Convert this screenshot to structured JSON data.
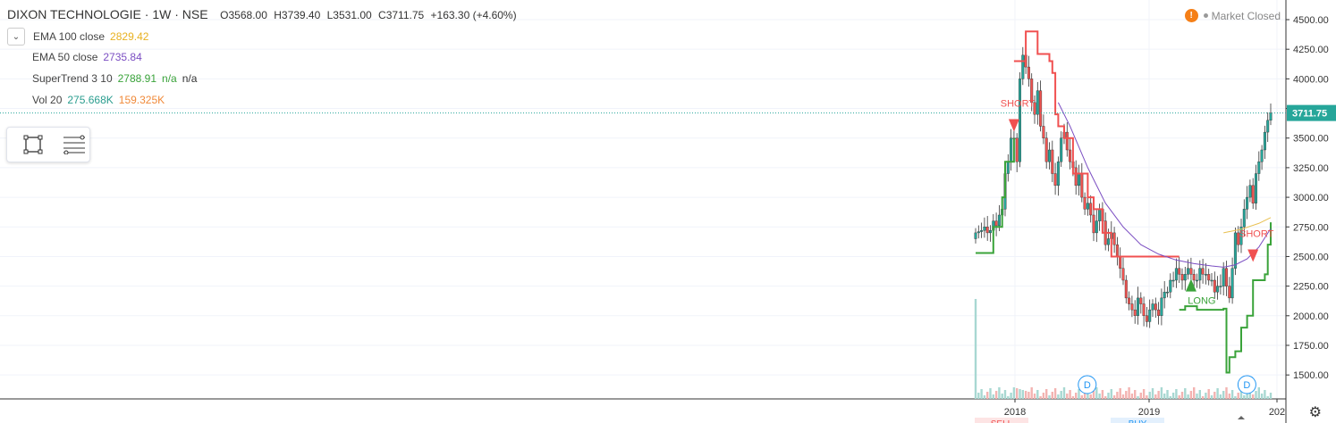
{
  "header": {
    "title": "DIXON TECHNOLOGIE · 1W · NSE",
    "open": "O3568.00",
    "high": "H3739.40",
    "low": "L3531.00",
    "close": "C3711.75",
    "change": "+163.30 (+4.60%)"
  },
  "indicators": [
    {
      "label": "EMA 100 close",
      "values": [
        "2829.42"
      ],
      "colors": [
        "#e8b120"
      ]
    },
    {
      "label": "EMA 50 close",
      "values": [
        "2735.84"
      ],
      "colors": [
        "#7b4ec2"
      ]
    },
    {
      "label": "SuperTrend 3 10",
      "values": [
        "2788.91",
        "n/a",
        "n/a"
      ],
      "colors": [
        "#3aa33a",
        "#3aa33a",
        "#333333"
      ]
    },
    {
      "label": "Vol 20",
      "values": [
        "275.668K",
        "159.325K"
      ],
      "colors": [
        "#2a9d8f",
        "#f08a3a"
      ]
    }
  ],
  "market_status": "Market Closed",
  "price_label": "3711.75",
  "icons": {
    "warning": "!",
    "settings": "⚙"
  },
  "colors": {
    "up": "#26a69a",
    "down": "#ef5350",
    "supertrend_up": "#3aa33a",
    "supertrend_down": "#f05050",
    "ema50": "#7b4ec2",
    "ema100": "#e8c050"
  },
  "chart_data": {
    "type": "candlestick",
    "title": "DIXON TECHNOLOGIE · 1W · NSE",
    "y_ticks": [
      1500,
      1750,
      2000,
      2250,
      2500,
      2750,
      3000,
      3250,
      3500,
      3750,
      4000,
      4250,
      4500
    ],
    "y_tick_labels": [
      "1500.00",
      "1750.00",
      "2000.00",
      "2250.00",
      "2500.00",
      "2750.00",
      "3000.00",
      "3250.00",
      "3500.00",
      "3750.00",
      "4000.00",
      "4250.00",
      "4500.00"
    ],
    "ylim": [
      1300,
      4550
    ],
    "x_labels": [
      "2018",
      "2019",
      "202"
    ],
    "x_label_dates": [
      "2018-01-01",
      "2019-01-01",
      "2020-01-01"
    ],
    "close_series": [
      2700,
      2710,
      2720,
      2750,
      2700,
      2720,
      2800,
      2760,
      2850,
      2900,
      3200,
      3300,
      3500,
      3500,
      3300,
      4000,
      4200,
      4100,
      4000,
      3800,
      3700,
      3900,
      3600,
      3500,
      3300,
      3400,
      3200,
      3100,
      3300,
      3500,
      3550,
      3400,
      3300,
      3250,
      3100,
      3200,
      3000,
      2900,
      2950,
      2850,
      2700,
      2800,
      2900,
      2800,
      2600,
      2650,
      2700,
      2600,
      2500,
      2400,
      2300,
      2150,
      2100,
      2050,
      2000,
      2150,
      2100,
      2000,
      1950,
      2050,
      2100,
      2050,
      2000,
      2150,
      2200,
      2200,
      2300,
      2300,
      2400,
      2350,
      2300,
      2350,
      2400,
      2350,
      2300,
      2300,
      2400,
      2350,
      2350,
      2300,
      2300,
      2200,
      2250,
      2250,
      2400,
      2250,
      2150,
      2400,
      2700,
      2600,
      2750,
      2900,
      3000,
      3100,
      2950,
      3200,
      3300,
      3400,
      3550,
      3650,
      3711.75
    ],
    "supertrend": [
      {
        "dir": "up",
        "values": [
          [
            0,
            2530
          ],
          [
            4,
            2530
          ],
          [
            6,
            2750
          ],
          [
            8,
            2750
          ],
          [
            9,
            3000
          ],
          [
            10,
            3300
          ],
          [
            12,
            3300
          ],
          [
            13,
            3500
          ]
        ]
      },
      {
        "dir": "down",
        "values": [
          [
            13,
            4150
          ],
          [
            16,
            4150
          ],
          [
            17,
            4400
          ],
          [
            20,
            4400
          ],
          [
            21,
            4210
          ],
          [
            25,
            4150
          ],
          [
            26,
            4050
          ],
          [
            27,
            3700
          ],
          [
            28,
            3600
          ],
          [
            30,
            3500
          ],
          [
            33,
            3200
          ],
          [
            37,
            3200
          ],
          [
            38,
            3000
          ],
          [
            40,
            2900
          ],
          [
            43,
            2700
          ],
          [
            46,
            2500
          ],
          [
            69,
            2500
          ]
        ]
      },
      {
        "dir": "up",
        "values": [
          [
            69,
            2050
          ],
          [
            71,
            2080
          ],
          [
            75,
            2050
          ],
          [
            84,
            2060
          ],
          [
            85,
            1520
          ],
          [
            86,
            1650
          ],
          [
            88,
            1700
          ],
          [
            90,
            1900
          ],
          [
            92,
            2000
          ],
          [
            94,
            2300
          ],
          [
            96,
            2300
          ],
          [
            98,
            2350
          ],
          [
            99,
            2600
          ],
          [
            100,
            2789
          ]
        ]
      }
    ],
    "ema50": [
      [
        28,
        3800
      ],
      [
        32,
        3600
      ],
      [
        38,
        3250
      ],
      [
        44,
        2950
      ],
      [
        50,
        2750
      ],
      [
        56,
        2600
      ],
      [
        62,
        2520
      ],
      [
        68,
        2470
      ],
      [
        74,
        2440
      ],
      [
        80,
        2420
      ],
      [
        84,
        2410
      ],
      [
        88,
        2430
      ],
      [
        92,
        2480
      ],
      [
        96,
        2580
      ],
      [
        100,
        2736
      ]
    ],
    "ema100": [
      [
        84,
        2700
      ],
      [
        90,
        2730
      ],
      [
        96,
        2780
      ],
      [
        100,
        2829
      ]
    ],
    "signals": [
      {
        "text": "SHORT",
        "type": "sell",
        "index": 13,
        "price": 3600
      },
      {
        "text": "LONG",
        "type": "buy",
        "index": 73,
        "price": 2250
      },
      {
        "text": "SHORT",
        "type": "sell",
        "index": 94,
        "price": 2500
      }
    ],
    "dividend_markers": [
      {
        "text": "D",
        "index": 56
      },
      {
        "text": "D",
        "index": 98
      }
    ],
    "bottom_labels": [
      "SELL",
      "BUY"
    ],
    "last_price": 3711.75
  }
}
